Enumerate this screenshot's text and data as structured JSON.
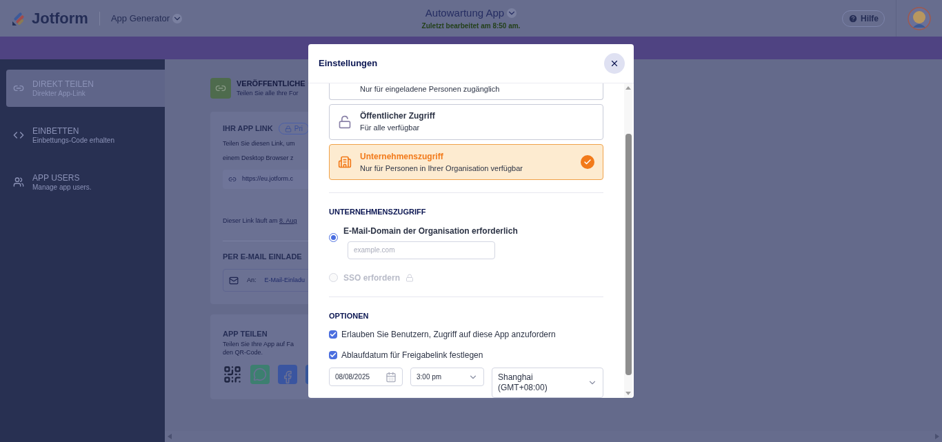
{
  "header": {
    "logo": "Jotform",
    "product": "App Generator",
    "app_title": "Autowartung App",
    "subtitle": "Zuletzt bearbeitet am 8:50 am.",
    "help": "Hilfe"
  },
  "sidebar": {
    "items": [
      {
        "kind": "link",
        "title": "DIREKT TEILEN",
        "subtitle": "Direkter App-Link",
        "selected": true
      },
      {
        "kind": "embed",
        "title": "EINBETTEN",
        "subtitle": "Einbettungs-Code erhalten",
        "selected": false
      },
      {
        "kind": "users",
        "title": "APP USERS",
        "subtitle": "Manage app users.",
        "selected": false
      }
    ]
  },
  "main": {
    "publish": {
      "title": "VERÖFFENTLICHE",
      "subtitle": "Teilen Sie alle Ihre For"
    },
    "app_link": {
      "title": "IHR APP LINK",
      "badge": "Pri",
      "description": [
        "Teilen Sie diesen Link, um",
        "einem Desktop Browser z"
      ],
      "url": "https://eu.jotform.c",
      "expiry": "Dieser Link läuft am ",
      "expiry_link": "8. Aug"
    },
    "email": {
      "title": "PER E-MAIL EINLADE",
      "prefix": "An:",
      "placeholder": "E-Mail-Einladu"
    },
    "share": {
      "title": "APP TEILEN",
      "description": "Teilen Sie Ihre App auf Fa",
      "description_2": "den QR-Code.",
      "icons": [
        {
          "kind": "qr"
        },
        {
          "kind": "whatsapp"
        },
        {
          "kind": "facebook"
        },
        {
          "kind": "linkedin"
        }
      ]
    }
  },
  "modal": {
    "title": "Einstellungen",
    "access_options": [
      {
        "description": "Nur für eingeladene Personen zugänglich",
        "selected": false
      },
      {
        "kind": "public",
        "title": "Öffentlicher Zugriff",
        "description": "Für alle verfügbar",
        "selected": false
      },
      {
        "kind": "company",
        "title": "Unternehmenszugriff",
        "description": "Nur für Personen in Ihrer Organisation verfügbar",
        "selected": true
      }
    ],
    "company_heading": "UNTERNEHMENSZUGRIFF",
    "radios": [
      {
        "kind": "domain",
        "label": "E-Mail-Domain der Organisation erforderlich",
        "selected": true,
        "disabled": false,
        "placeholder": "example.com"
      },
      {
        "kind": "sso",
        "label": "SSO erfordern",
        "selected": false,
        "disabled": true
      }
    ],
    "options_heading": "OPTIONEN",
    "checkboxes": [
      {
        "label": "Erlauben Sie Benutzern, Zugriff auf diese App anzufordern",
        "checked": true
      },
      {
        "label": "Ablaufdatum für Freigabelink festlegen",
        "checked": true
      }
    ],
    "date": "08/08/2025",
    "time": "3:00 pm",
    "timezone": "Shanghai (GMT+08:00)"
  }
}
